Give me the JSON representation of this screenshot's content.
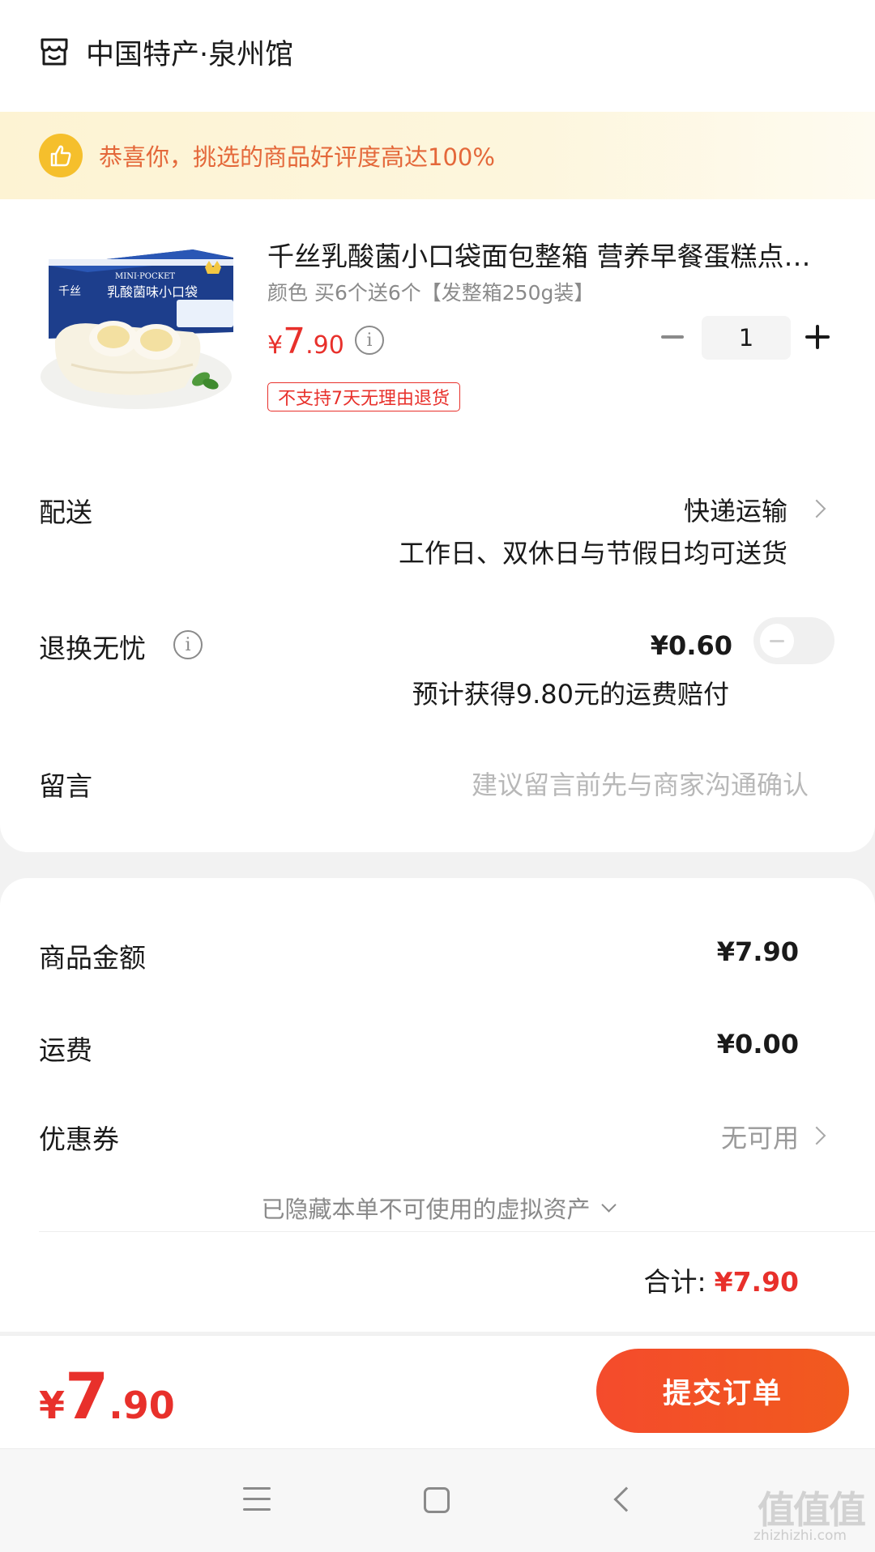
{
  "shop": {
    "name": "中国特产·泉州馆",
    "icon": "shop-icon"
  },
  "praise": {
    "icon": "thumbs-up-icon",
    "text": "恭喜你，挑选的商品好评度高达100%"
  },
  "product": {
    "image_icon": "product-image",
    "title": "千丝乳酸菌小口袋面包整箱 营养早餐蛋糕点心零食品小吃休闲食品",
    "spec": "颜色 买6个送6个【发整箱250g装】",
    "price_currency": "¥",
    "price_int": "7",
    "price_dec": ".90",
    "quantity": "1",
    "return_tag": "不支持7天无理由退货",
    "package_labels": {
      "brand": "千丝",
      "en": "MINI·POCKET",
      "cn": "乳酸菌味小口袋"
    }
  },
  "delivery": {
    "label": "配送",
    "method": "快递运输",
    "note": "工作日、双休日与节假日均可送货"
  },
  "worry_free": {
    "label": "退换无忧",
    "price": "¥0.60",
    "note": "预计获得9.80元的运费赔付",
    "enabled": false
  },
  "message": {
    "label": "留言",
    "placeholder": "建议留言前先与商家沟通确认"
  },
  "summary": {
    "goods_label": "商品金额",
    "goods_value": "¥7.90",
    "shipping_label": "运费",
    "shipping_value": "¥0.00",
    "coupon_label": "优惠券",
    "coupon_value": "无可用",
    "hidden_assets": "已隐藏本单不可使用的虚拟资产",
    "total_label": "合计:",
    "total_value": "¥7.90"
  },
  "footer": {
    "price_currency": "¥",
    "price_int": "7",
    "price_dec": ".90",
    "submit_label": "提交订单"
  },
  "watermark": {
    "big": "值值值",
    "small": "zhizhizhi.com"
  },
  "colors": {
    "accent": "#e8302b",
    "submit": "#f44b2c",
    "praise_bg": "#fdf3d3",
    "praise_text": "#e4683a"
  }
}
